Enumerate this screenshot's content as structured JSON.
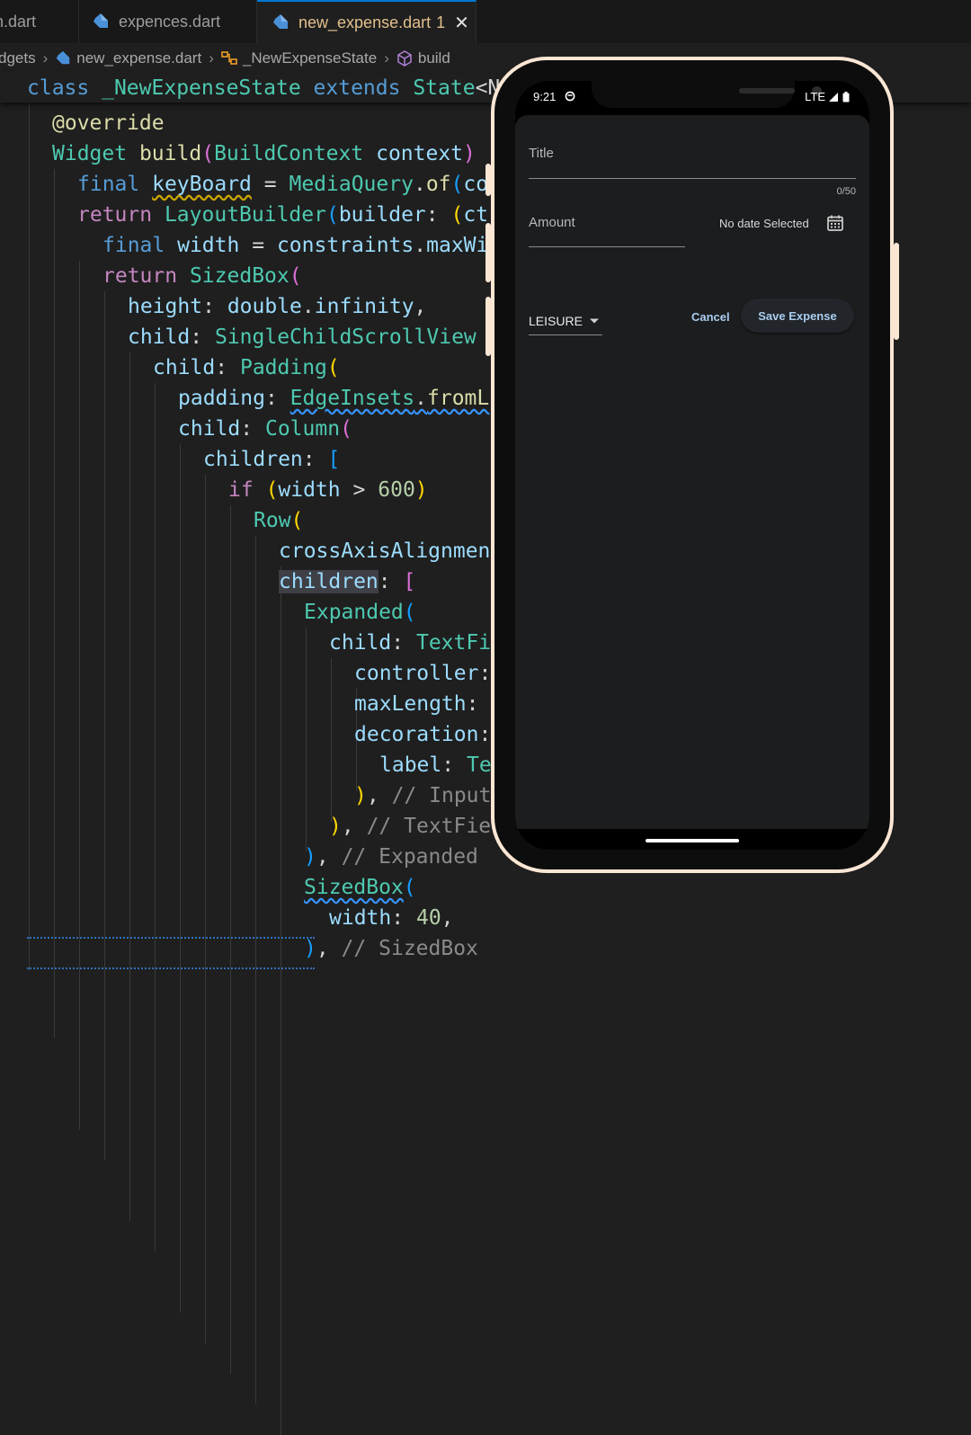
{
  "editor": {
    "tabs": [
      {
        "label": "n.dart"
      },
      {
        "label": "expences.dart"
      },
      {
        "label": "new_expense.dart",
        "badge": "1"
      }
    ],
    "breadcrumb": [
      "dgets",
      "new_expense.dart",
      "_NewExpenseState",
      "build"
    ],
    "sticky_line": "class _NewExpenseState extends State<N",
    "colors": {
      "accent": "#0078d4",
      "background": "#1f1f1f",
      "modified_tab": "#e2c08d"
    }
  },
  "phone": {
    "status": {
      "time": "9:21",
      "network": "LTE"
    },
    "form": {
      "title_label": "Title",
      "title_counter": "0/50",
      "amount_label": "Amount",
      "date_text": "No date Selected",
      "category": "LEISURE",
      "cancel_label": "Cancel",
      "save_label": "Save Expense"
    },
    "colors": {
      "frame": "#fbe6d4",
      "app_background": "#1b1d1f",
      "button_text": "#a9cdef"
    }
  }
}
